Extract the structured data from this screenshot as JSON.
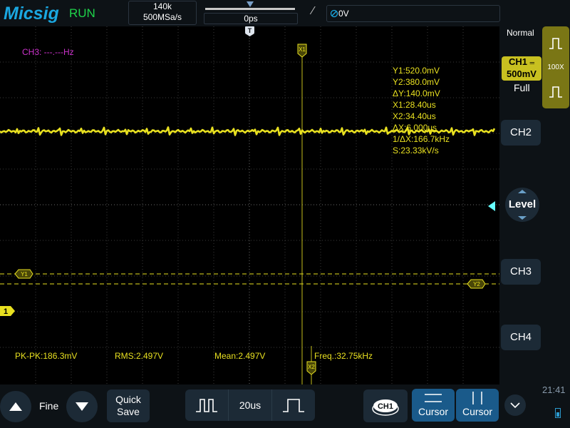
{
  "top": {
    "brand": "Micsig",
    "status": "RUN",
    "memory_depth": "140k",
    "sample_rate": "500MSa/s",
    "trigger_offset": "0ps",
    "trigger_slope_icon": "rising-edge-icon",
    "trigger_source_value": "0V"
  },
  "markers": {
    "trigger_pos": "T",
    "x1": "X1",
    "x2": "X2",
    "y1": "Y1",
    "y2": "Y2",
    "ch1": "1"
  },
  "freq_counter": "CH3: ---.---Hz",
  "cursor_readout": [
    "Y1:520.0mV",
    "Y2:380.0mV",
    "ΔY:140.0mV",
    "X1:28.40us",
    "X2:34.40us",
    "ΔX:6.000us",
    "1/ΔX:166.7kHz",
    "S:23.33kV/s"
  ],
  "measurements": {
    "pkpk": "PK-PK:186.3mV",
    "rms": "RMS:2.497V",
    "mean": "Mean:2.497V",
    "freq": "Freq.:32.75kHz"
  },
  "right_panel": {
    "trigger_mode": "Normal",
    "ch1_label": "CH1",
    "ch1_scale": "500mV",
    "ch1_bandwidth": "Full",
    "probe_ratio": "100X",
    "ch2": "CH2",
    "level": "Level",
    "ch3": "CH3",
    "ch4": "CH4"
  },
  "bottom": {
    "fine": "Fine",
    "quick_save_line1": "Quick",
    "quick_save_line2": "Save",
    "timebase": "20us",
    "ch1_chip": "CH1",
    "cursor_h": "Cursor",
    "cursor_v": "Cursor",
    "clock": "21:41"
  },
  "colors": {
    "ch1_trace": "#e8e020",
    "freq_counter": "#cc33cc",
    "accent": "#1aa7e0",
    "run": "#1ed34a",
    "level_arrow": "#66ffff"
  }
}
